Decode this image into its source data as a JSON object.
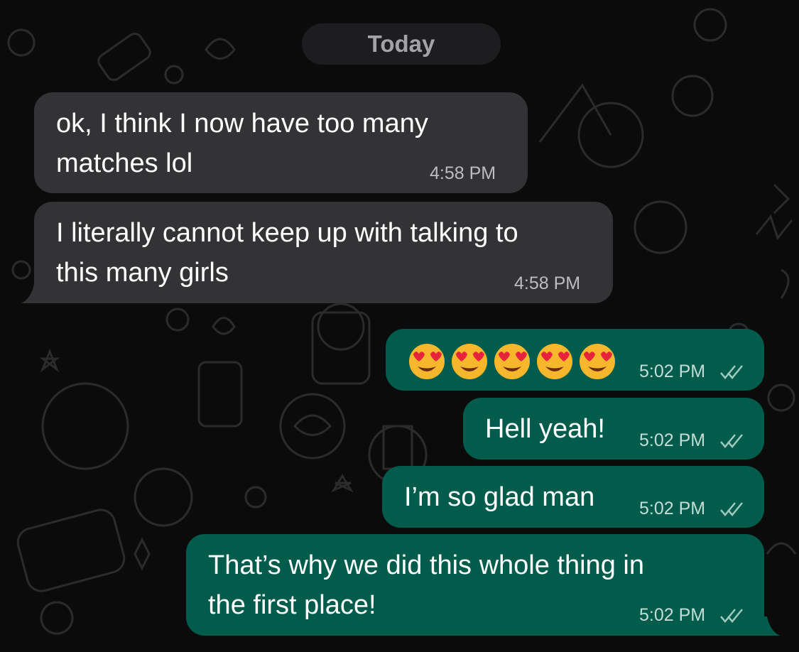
{
  "date_separator": {
    "label": "Today"
  },
  "messages": [
    {
      "direction": "incoming",
      "lines": [
        "ok, I think I now have too many",
        "matches lol"
      ],
      "time": "4:58 PM"
    },
    {
      "direction": "incoming",
      "lines": [
        "I literally cannot keep up with talking to",
        "this many girls"
      ],
      "time": "4:58 PM"
    },
    {
      "direction": "outgoing",
      "emoji": [
        "heart-eyes-emoji",
        "heart-eyes-emoji",
        "heart-eyes-emoji",
        "heart-eyes-emoji",
        "heart-eyes-emoji"
      ],
      "time": "5:02 PM",
      "status": "read"
    },
    {
      "direction": "outgoing",
      "lines": [
        "Hell yeah!"
      ],
      "time": "5:02 PM",
      "status": "read"
    },
    {
      "direction": "outgoing",
      "lines": [
        "I’m so glad man"
      ],
      "time": "5:02 PM",
      "status": "read"
    },
    {
      "direction": "outgoing",
      "lines": [
        "That’s why we did this whole thing in",
        "the first place!"
      ],
      "time": "5:02 PM",
      "status": "read"
    }
  ],
  "colors": {
    "background": "#0b0b0c",
    "incoming_bubble": "#333335",
    "outgoing_bubble": "#015c4b",
    "date_pill": "#1d1d1f"
  }
}
